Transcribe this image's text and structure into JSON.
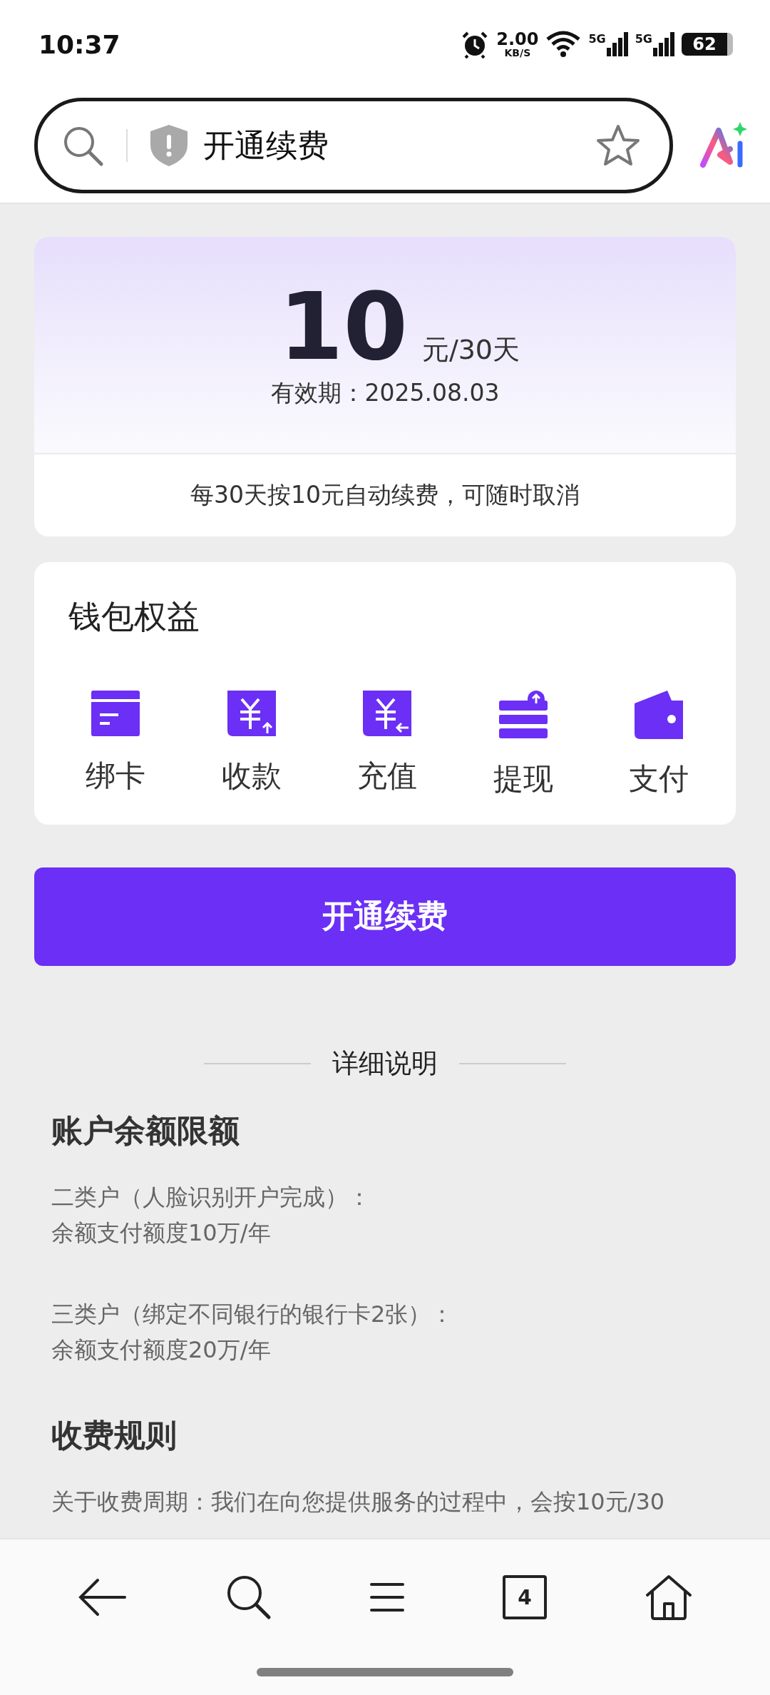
{
  "status_bar": {
    "time": "10:37",
    "net_speed": "2.00",
    "net_unit": "KB/S",
    "signals": [
      "5G",
      "5G"
    ],
    "battery": "62"
  },
  "search_bar": {
    "query": "开通续费"
  },
  "plan": {
    "amount": "10",
    "unit": "元/30天",
    "validity": "有效期：2025.08.03",
    "note": "每30天按10元自动续费，可随时取消"
  },
  "benefits": {
    "title": "钱包权益",
    "items": [
      {
        "label": "绑卡",
        "kind": "card"
      },
      {
        "label": "收款",
        "kind": "receive"
      },
      {
        "label": "充值",
        "kind": "recharge"
      },
      {
        "label": "提现",
        "kind": "withdraw"
      },
      {
        "label": "支付",
        "kind": "pay"
      }
    ]
  },
  "primary_button": "开通续费",
  "details": {
    "title": "详细说明",
    "sections": [
      {
        "heading": "账户余额限额",
        "paragraphs": [
          [
            "二类户（人脸识别开户完成）：",
            "余额支付额度10万/年"
          ],
          [
            "三类户（绑定不同银行的银行卡2张）：",
            "余额支付额度20万/年"
          ]
        ]
      },
      {
        "heading": "收费规则",
        "paragraphs": [
          [
            "关于收费周期：我们在向您提供服务的过程中，会按10元/30"
          ]
        ]
      }
    ]
  },
  "bottom_nav": {
    "tab_count": "4"
  }
}
